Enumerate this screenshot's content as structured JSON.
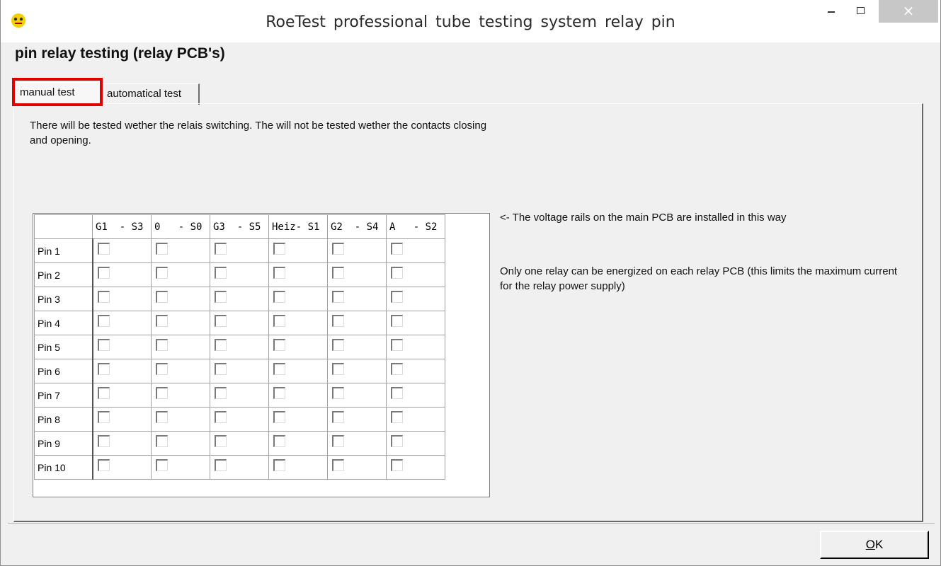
{
  "window": {
    "title": "RoeTest   professional tube testing system  relay pin",
    "icon": "app-logo-icon",
    "controls": {
      "minimize_icon": "minimize-icon",
      "maximize_icon": "maximize-icon",
      "close_label": "×"
    }
  },
  "dialog": {
    "heading": "pin relay testing (relay PCB's)",
    "tabs": [
      {
        "label": "manual test",
        "selected": true
      },
      {
        "label": "automatical test",
        "selected": false
      }
    ],
    "description": "There will be tested wether the relais switching. The will not be tested wether the contacts closing and opening.",
    "note_rails": "<- The voltage rails on the main PCB are installed in this way",
    "note_limit": "Only one relay can be energized on each relay PCB (this limits the maximum current for the relay power supply)",
    "grid": {
      "columns": [
        "G1  - S3",
        "0   - S0",
        "G3  - S5",
        "Heiz- S1",
        "G2  - S4",
        "A   - S2"
      ],
      "rows": [
        "Pin 1",
        "Pin 2",
        "Pin 3",
        "Pin 4",
        "Pin 5",
        "Pin 6",
        "Pin 7",
        "Pin 8",
        "Pin 9",
        "Pin 10"
      ],
      "checked": false
    },
    "ok_label_accel": "O",
    "ok_label_rest": "K"
  },
  "colors": {
    "highlight": "#e00000",
    "window_bg": "#f0f0f0",
    "close_button": "#c7c7c7"
  }
}
